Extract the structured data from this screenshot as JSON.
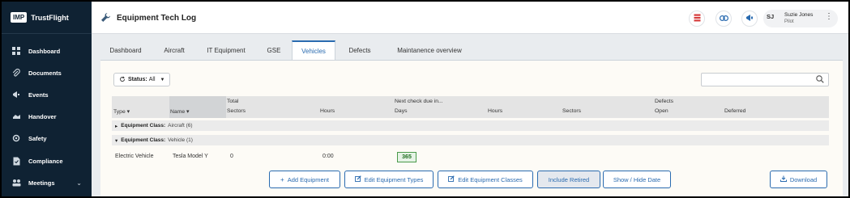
{
  "brand": {
    "logo": "IMP",
    "name": "TrustFlight"
  },
  "sidebar": {
    "items": [
      {
        "label": "Dashboard",
        "icon": "dashboard-icon"
      },
      {
        "label": "Documents",
        "icon": "paperclip-icon"
      },
      {
        "label": "Events",
        "icon": "megaphone-icon"
      },
      {
        "label": "Handover",
        "icon": "handover-icon"
      },
      {
        "label": "Safety",
        "icon": "safety-icon"
      },
      {
        "label": "Compliance",
        "icon": "compliance-icon"
      },
      {
        "label": "Meetings",
        "icon": "meetings-icon",
        "chevron": "⌄"
      }
    ]
  },
  "header": {
    "title": "Equipment Tech Log"
  },
  "user": {
    "initials": "SJ",
    "name": "Suzie Jones",
    "role": "Pilot"
  },
  "tabs": [
    {
      "label": "Dashboard"
    },
    {
      "label": "Aircraft"
    },
    {
      "label": "IT Equipment"
    },
    {
      "label": "GSE"
    },
    {
      "label": "Vehicles",
      "active": true
    },
    {
      "label": "Defects"
    },
    {
      "label": "Maintanence overview"
    }
  ],
  "filter": {
    "label": "Status:",
    "value": "All"
  },
  "search": {
    "placeholder": ""
  },
  "table": {
    "group_total": "Total",
    "group_next_check": "Next check due in...",
    "group_defects": "Defects",
    "columns": {
      "type": "Type",
      "name": "Name",
      "sectors": "Sectors",
      "hours": "Hours",
      "days": "Days",
      "next_hours": "Hours",
      "next_sectors": "Sectors",
      "open": "Open",
      "deferred": "Deferred"
    },
    "groups": [
      {
        "label": "Equipment Class:",
        "value": "Aircraft (6)"
      },
      {
        "label": "Equipment Class:",
        "value": "Vehicle (1)"
      }
    ],
    "rows": [
      {
        "type": "Electric Vehicle",
        "name": "Tesla Model Y",
        "sectors": "0",
        "hours": "0:00",
        "days": "365"
      }
    ]
  },
  "actions": {
    "add": "Add Equipment",
    "edit_types": "Edit Equipment Types",
    "edit_classes": "Edit Equipment Classes",
    "include_retired": "Include Retired",
    "show_hide_date": "Show / Hide Date",
    "download": "Download"
  },
  "colors": {
    "sidebar": "#0f2233",
    "accent": "#2a6bb0",
    "due_ok": "#4a9a4a"
  }
}
